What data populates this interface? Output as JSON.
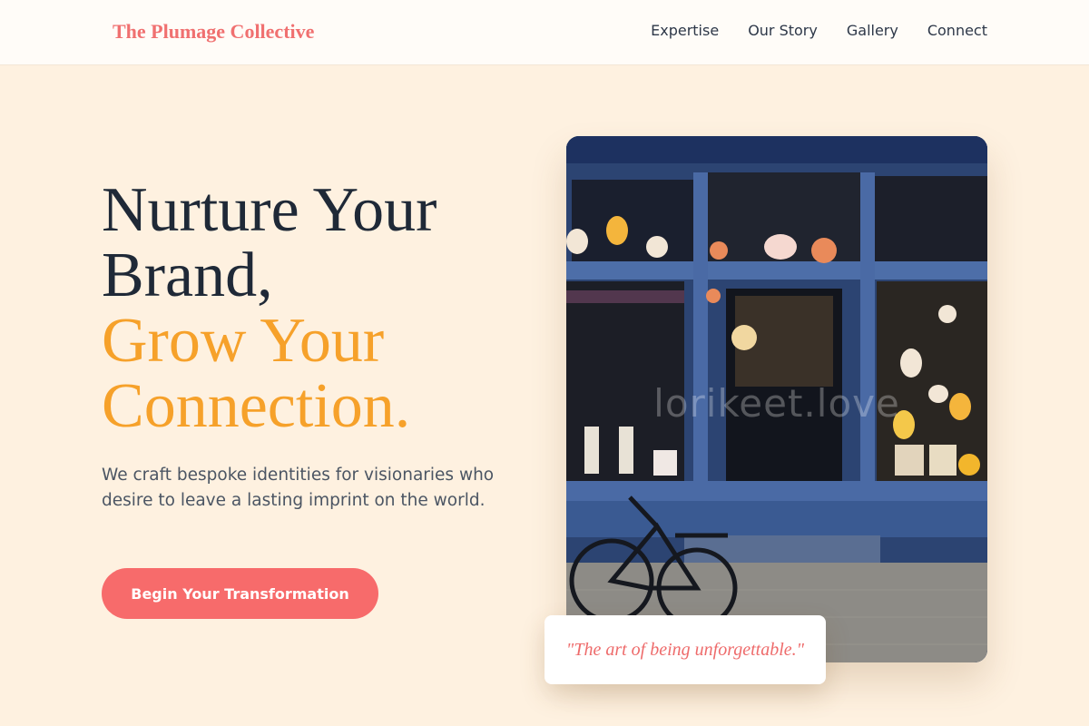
{
  "header": {
    "brand": "The Plumage Collective",
    "nav": [
      "Expertise",
      "Our Story",
      "Gallery",
      "Connect"
    ]
  },
  "hero": {
    "title_line1": "Nurture Your",
    "title_line2": "Brand,",
    "title_accent_line1": "Grow Your",
    "title_accent_line2": "Connection.",
    "tagline": "We craft bespoke identities for visionaries who desire to leave a lasting imprint on the world.",
    "cta_label": "Begin Your Transformation"
  },
  "image": {
    "watermark": "lorikeet.love"
  },
  "quote": {
    "text": "\"The art of being unforgettable.\""
  },
  "colors": {
    "background": "#fef1e0",
    "brand": "#f07070",
    "accent": "#f6a12a",
    "cta": "#f76b6b"
  }
}
